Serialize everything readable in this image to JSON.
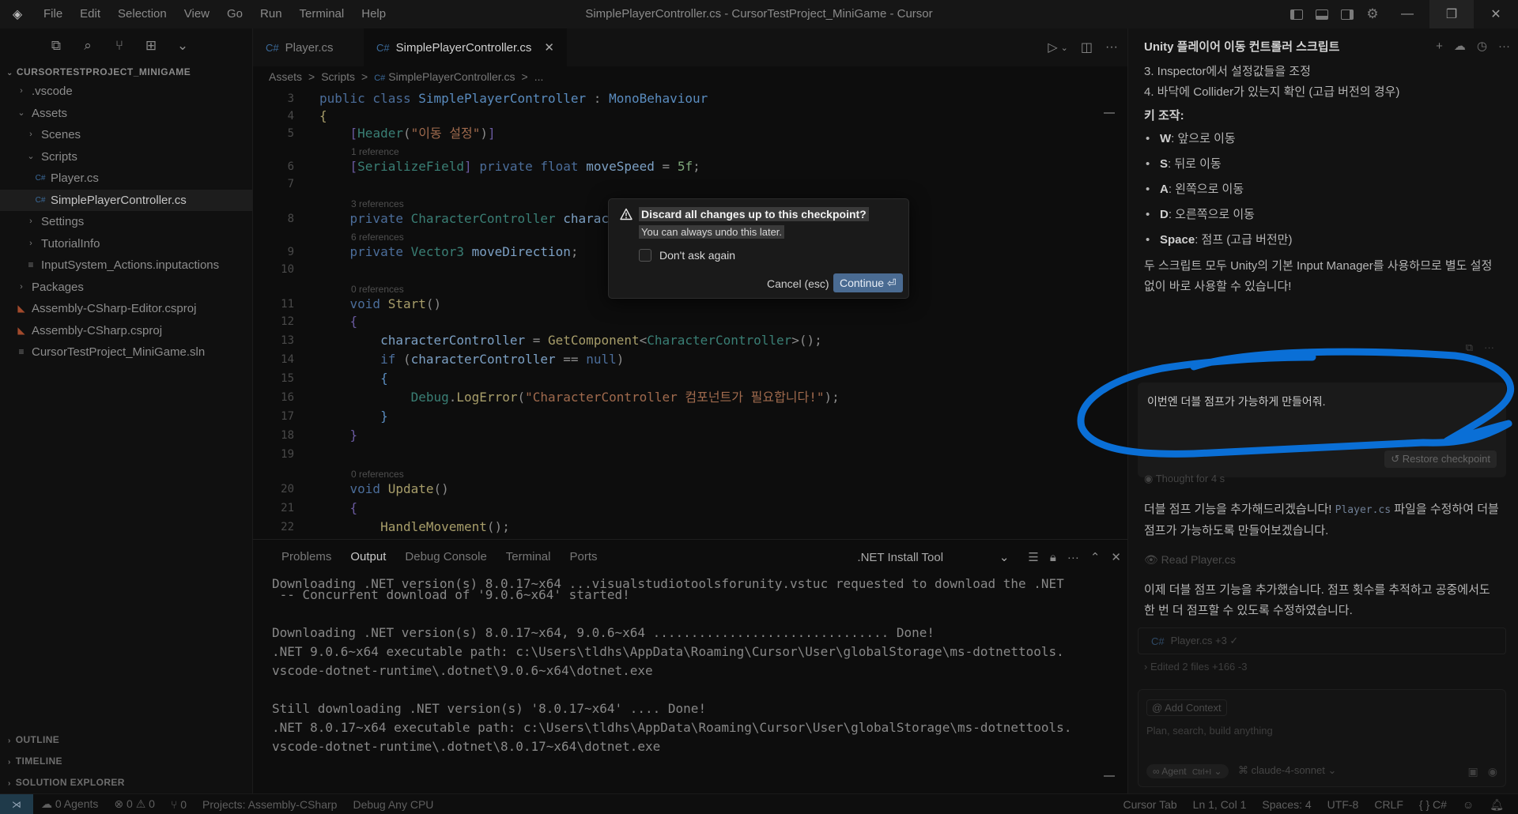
{
  "titlebar": {
    "menu": [
      "File",
      "Edit",
      "Selection",
      "View",
      "Go",
      "Run",
      "Terminal",
      "Help"
    ],
    "window_title": "SimplePlayerController.cs - CursorTestProject_MiniGame - Cursor"
  },
  "sidebar": {
    "root": "CURSORTESTPROJECT_MINIGAME",
    "tree": [
      {
        "label": ".vscode",
        "indent": 0,
        "kind": "folder",
        "expanded": false
      },
      {
        "label": "Assets",
        "indent": 0,
        "kind": "folder",
        "expanded": true
      },
      {
        "label": "Scenes",
        "indent": 1,
        "kind": "folder",
        "expanded": false
      },
      {
        "label": "Scripts",
        "indent": 1,
        "kind": "folder",
        "expanded": true
      },
      {
        "label": "Player.cs",
        "indent": 2,
        "kind": "cs"
      },
      {
        "label": "SimplePlayerController.cs",
        "indent": 2,
        "kind": "cs",
        "selected": true
      },
      {
        "label": "Settings",
        "indent": 1,
        "kind": "folder",
        "expanded": false
      },
      {
        "label": "TutorialInfo",
        "indent": 1,
        "kind": "folder",
        "expanded": false
      },
      {
        "label": "InputSystem_Actions.inputactions",
        "indent": 1,
        "kind": "file"
      },
      {
        "label": "Packages",
        "indent": 0,
        "kind": "folder",
        "expanded": false
      },
      {
        "label": "Assembly-CSharp-Editor.csproj",
        "indent": 0,
        "kind": "proj"
      },
      {
        "label": "Assembly-CSharp.csproj",
        "indent": 0,
        "kind": "proj"
      },
      {
        "label": "CursorTestProject_MiniGame.sln",
        "indent": 0,
        "kind": "file"
      }
    ],
    "sections": [
      "OUTLINE",
      "TIMELINE",
      "SOLUTION EXPLORER"
    ]
  },
  "editor": {
    "tabs": [
      {
        "label": "Player.cs",
        "active": false
      },
      {
        "label": "SimplePlayerController.cs",
        "active": true
      }
    ],
    "breadcrumb": [
      "Assets",
      ">",
      "Scripts",
      ">",
      "SimplePlayerController.cs",
      ">",
      "..."
    ],
    "line_numbers": [
      "3",
      "4",
      "5",
      "6",
      "7",
      "8",
      "9",
      "10",
      "11",
      "12",
      "13",
      "14",
      "15",
      "16",
      "17",
      "18",
      "19",
      "20",
      "21",
      "22"
    ],
    "codelens": [
      "1 reference",
      "3 references",
      "6 references",
      "0 references",
      "0 references"
    ]
  },
  "panel": {
    "tabs": [
      "Problems",
      "Output",
      "Debug Console",
      "Terminal",
      "Ports"
    ],
    "active_tab": "Output",
    "channel": ".NET Install Tool",
    "output_lines": [
      "Downloading .NET version(s) 8.0.17~x64 ...visualstudiotoolsforunity.vstuc requested to download the .NET",
      " -- Concurrent download of '9.0.6~x64' started!",
      "",
      "Downloading .NET version(s) 8.0.17~x64, 9.0.6~x64 ............................... Done!",
      ".NET 9.0.6~x64 executable path: c:\\Users\\tldhs\\AppData\\Roaming\\Cursor\\User\\globalStorage\\ms-dotnettools.",
      "vscode-dotnet-runtime\\.dotnet\\9.0.6~x64\\dotnet.exe",
      "",
      "Still downloading .NET version(s) '8.0.17~x64' .... Done!",
      ".NET 8.0.17~x64 executable path: c:\\Users\\tldhs\\AppData\\Roaming\\Cursor\\User\\globalStorage\\ms-dotnettools.",
      "vscode-dotnet-runtime\\.dotnet\\8.0.17~x64\\dotnet.exe"
    ]
  },
  "chat": {
    "title": "Unity 플레이어 이동 컨트롤러 스크립트",
    "steps": [
      "3. Inspector에서 설정값들을 조정",
      "4. 바닥에 Collider가 있는지 확인 (고급 버전의 경우)"
    ],
    "keys_heading": "키 조작:",
    "keys": [
      {
        "key": "W",
        "desc": ": 앞으로 이동"
      },
      {
        "key": "S",
        "desc": ": 뒤로 이동"
      },
      {
        "key": "A",
        "desc": ": 왼쪽으로 이동"
      },
      {
        "key": "D",
        "desc": ": 오른쪽으로 이동"
      },
      {
        "key": "Space",
        "desc": ": 점프 (고급 버전만)"
      }
    ],
    "summary": "두 스크립트 모두 Unity의 기본 Input Manager를 사용하므로 별도 설정 없이 바로 사용할 수 있습니다!",
    "user_message": "이번엔 더블 점프가 가능하게 만들어줘.",
    "restore_label": "Restore checkpoint",
    "thought_label": "Thought for 4 s",
    "reply_1a": "더블 점프 기능을 추가해드리겠습니다! ",
    "reply_1_code": "Player.cs",
    "reply_1b": " 파일을 수정하여 더블 점프가 가능하도록 만들어보겠습니다.",
    "read_label": "Read Player.cs",
    "reply_2": "이제 더블 점프 기능을 추가했습니다. 점프 횟수를 추적하고 공중에서도 한 번 더 점프할 수 있도록 수정하였습니다.",
    "file_change": "Player.cs +3 ✓",
    "edited_label": "Edited 2 files +166 -3",
    "add_context": "Add Context",
    "composer_placeholder": "Plan, search, build anything",
    "agent_label": "Agent",
    "agent_shortcut": "Ctrl+I",
    "model_label": "claude-4-sonnet"
  },
  "statusbar": {
    "agents": "0 Agents",
    "problems": "0",
    "warnings": "0",
    "ports": "0",
    "projects": "Projects: Assembly-CSharp",
    "config": "Debug Any CPU",
    "right": [
      "Cursor Tab",
      "Ln 1, Col 1",
      "Spaces: 4",
      "UTF-8",
      "CRLF",
      "{ } C#"
    ]
  },
  "dialog": {
    "title": "Discard all changes up to this checkpoint?",
    "subtitle": "You can always undo this later.",
    "checkbox_label": "Don't ask again",
    "cancel_label": "Cancel (esc)",
    "continue_label": "Continue ⏎"
  },
  "colors": {
    "accent_button": "#4a6b92",
    "annotation_stroke": "#0a6fd6",
    "background": "#0b0b0b"
  }
}
